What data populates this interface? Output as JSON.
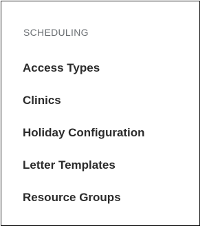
{
  "section": {
    "title": "SCHEDULING"
  },
  "menu": {
    "items": [
      {
        "label": "Access Types"
      },
      {
        "label": "Clinics"
      },
      {
        "label": "Holiday Configuration"
      },
      {
        "label": "Letter Templates"
      },
      {
        "label": "Resource Groups"
      }
    ]
  }
}
